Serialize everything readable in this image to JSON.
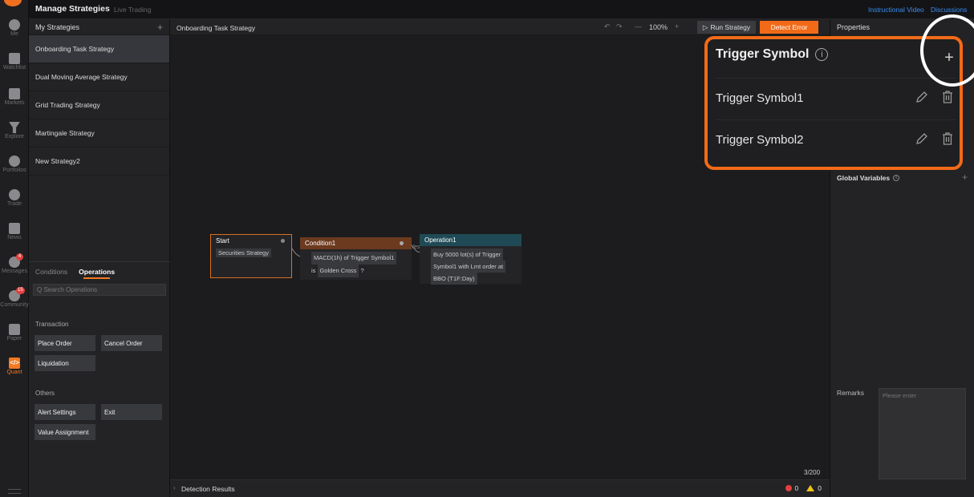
{
  "colors": {
    "accent": "#f26a18",
    "link": "#3a8ef0",
    "condition_header": "#6b3a1f",
    "operation_header": "#1f4a55",
    "error": "#e0413e",
    "warning": "#f0c21a"
  },
  "nav_rail": {
    "items": [
      {
        "label": "Me",
        "icon": "user-icon"
      },
      {
        "label": "Watchlist",
        "icon": "chart-bar-icon"
      },
      {
        "label": "Markets",
        "icon": "trend-icon"
      },
      {
        "label": "Explore",
        "icon": "funnel-icon"
      },
      {
        "label": "Portfolios",
        "icon": "pie-icon"
      },
      {
        "label": "Trade",
        "icon": "trade-icon"
      },
      {
        "label": "News",
        "icon": "news-icon"
      },
      {
        "label": "Messages",
        "icon": "chat-icon",
        "badge": "4"
      },
      {
        "label": "Community",
        "icon": "community-icon",
        "badge": "15"
      },
      {
        "label": "Paper",
        "icon": "paper-icon"
      },
      {
        "label": "Quant",
        "icon": "code-icon",
        "glyph": "</>"
      }
    ]
  },
  "header": {
    "title": "Manage Strategies",
    "subtitle": "Live Trading",
    "links": [
      "Instructional Video",
      "Discussions"
    ]
  },
  "strategy_list": {
    "heading": "My Strategies",
    "add_glyph": "+",
    "items": [
      "Onboarding Task Strategy",
      "Dual Moving Average Strategy",
      "Grid Trading Strategy",
      "Martingale Strategy",
      "New Strategy2"
    ]
  },
  "ops_panel": {
    "tabs": [
      "Conditions",
      "Operations"
    ],
    "active_tab": "Operations",
    "search_placeholder": "Q  Search Operations",
    "transaction_label": "Transaction",
    "transaction_buttons": [
      "Place Order",
      "Cancel Order",
      "Liquidation"
    ],
    "others_label": "Others",
    "other_buttons": [
      "Alert Settings",
      "Exit",
      "Value Assignment"
    ]
  },
  "canvas": {
    "strategy_name": "Onboarding Task Strategy",
    "undo": "↶",
    "redo": "↷",
    "zoom_out": "—",
    "zoom_level": "100%",
    "zoom_in": "+",
    "run_button": "Run Strategy",
    "run_glyph": "▷",
    "detect_button": "Detect Error",
    "char_count": "3/200",
    "detection_label": "Detection Results",
    "error_count": "0",
    "warning_count": "0"
  },
  "flow": {
    "start": {
      "title": "Start",
      "body": "Securities Strategy"
    },
    "condition": {
      "title": "Condition1",
      "line1": "MACD(1h) of Trigger Symbol1",
      "is_word": "is",
      "value": "Golden Cross",
      "question": "?"
    },
    "edge_label": "Yes",
    "operation": {
      "title": "Operation1",
      "line1": "Buy 5000 lot(s) of Trigger",
      "line2": "Symbol1 with Lmt order at",
      "line3": "BBO  (T1F:Day)"
    }
  },
  "properties": {
    "heading": "Properties",
    "global_variables": "Global Variables",
    "info_glyph": "i",
    "add_glyph": "+",
    "remarks_label": "Remarks",
    "remarks_placeholder": "Please enter"
  },
  "callout": {
    "title": "Trigger Symbol",
    "info_glyph": "i",
    "add_glyph": "+",
    "rows": [
      "Trigger Symbol1",
      "Trigger Symbol2"
    ]
  }
}
